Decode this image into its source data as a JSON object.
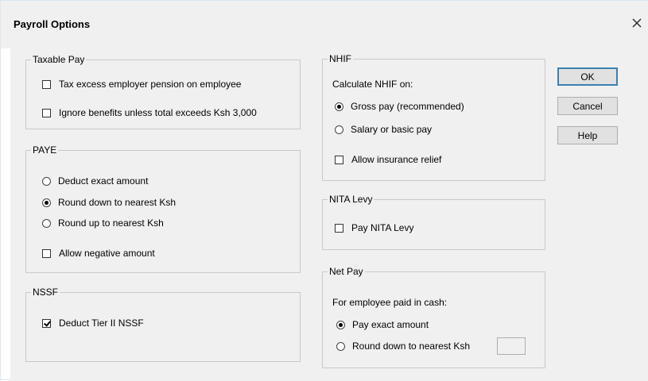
{
  "window": {
    "title": "Payroll Options",
    "close_icon": "close-icon"
  },
  "taxable_pay": {
    "legend": "Taxable Pay",
    "tax_excess_pension": {
      "label": "Tax excess employer pension on employee",
      "checked": false
    },
    "ignore_benefits": {
      "label": "Ignore benefits unless total exceeds Ksh 3,000",
      "checked": false
    }
  },
  "paye": {
    "legend": "PAYE",
    "options": [
      {
        "label": "Deduct exact amount",
        "selected": false
      },
      {
        "label": "Round down to nearest Ksh",
        "selected": true
      },
      {
        "label": "Round up to nearest Ksh",
        "selected": false
      }
    ],
    "allow_negative": {
      "label": "Allow negative amount",
      "checked": false
    }
  },
  "nssf": {
    "legend": "NSSF",
    "deduct_tier2": {
      "label": "Deduct Tier II NSSF",
      "checked": true
    }
  },
  "nhif": {
    "legend": "NHIF",
    "prompt": "Calculate NHIF on:",
    "options": [
      {
        "label": "Gross pay (recommended)",
        "selected": true
      },
      {
        "label": "Salary or basic pay",
        "selected": false
      }
    ],
    "insurance_relief": {
      "label": "Allow insurance relief",
      "checked": false
    }
  },
  "nita": {
    "legend": "NITA Levy",
    "pay_nita": {
      "label": "Pay NITA Levy",
      "checked": false
    }
  },
  "net_pay": {
    "legend": "Net Pay",
    "prompt": "For employee paid in cash:",
    "options": [
      {
        "label": "Pay exact amount",
        "selected": true
      },
      {
        "label": "Round down to nearest Ksh",
        "selected": false
      }
    ],
    "round_value": ""
  },
  "buttons": {
    "ok": "OK",
    "cancel": "Cancel",
    "help": "Help"
  }
}
